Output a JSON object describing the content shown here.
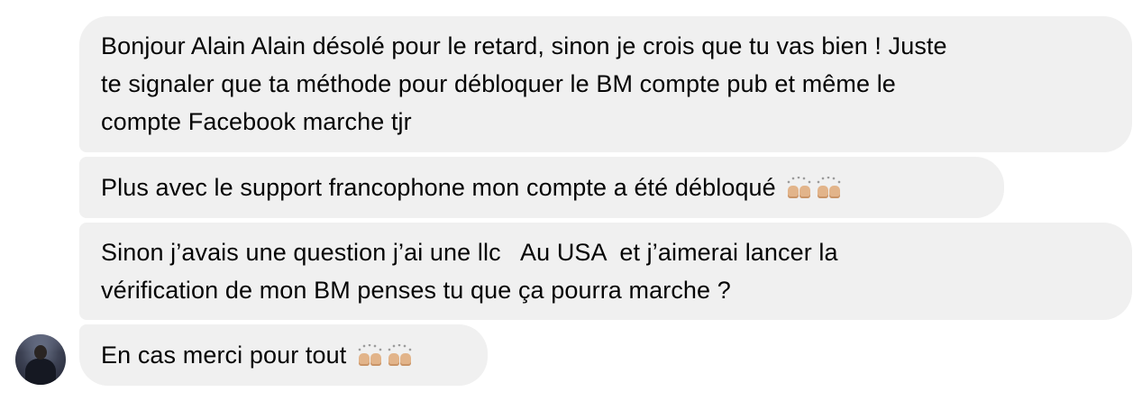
{
  "messages": [
    {
      "lines": [
        "Bonjour Alain Alain désolé pour le retard, sinon je crois que tu vas bien ! Juste",
        "te signaler que ta méthode pour débloquer le BM compte pub et même le",
        "compte Facebook marche tjr"
      ]
    },
    {
      "text": "Plus avec le support francophone mon compte a été débloqué",
      "emojis": [
        "raising-hands-icon",
        "raising-hands-icon"
      ]
    },
    {
      "lines": [
        "Sinon j’avais une question j’ai une llc   Au USA  et j’aimerai lancer la",
        "vérification de mon BM penses tu que ça pourra marche ?"
      ]
    },
    {
      "text": "En cas merci pour tout",
      "emojis": [
        "raising-hands-icon",
        "raising-hands-icon"
      ]
    }
  ],
  "colors": {
    "bubble_background": "#f0f0f0",
    "text": "#050505",
    "emoji_skin": "#e2b48a"
  }
}
